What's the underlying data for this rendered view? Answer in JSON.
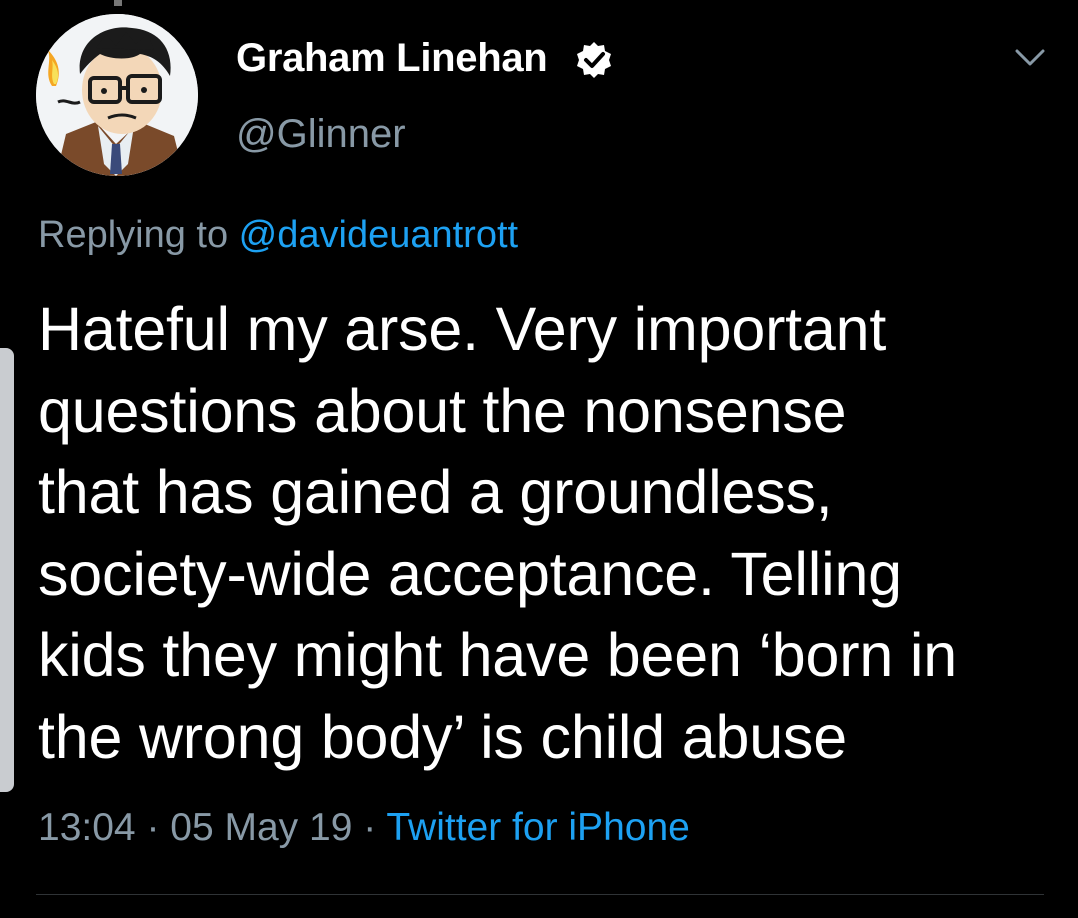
{
  "author": {
    "display_name": "Graham Linehan",
    "handle": "@Glinner",
    "verified": true,
    "avatar": "cartoon-avatar-icon"
  },
  "reply": {
    "prefix": "Replying to ",
    "to_handle": "@davideuantrott"
  },
  "tweet": {
    "text": "Hateful my arse. Very important\nquestions about the nonsense\nthat has  gained a groundless,\nsociety-wide acceptance. Telling\nkids they might have been ‘born in\nthe wrong body’ is child abuse"
  },
  "meta": {
    "time": "13:04",
    "separator": " · ",
    "date": "05 May 19",
    "separator2": " · ",
    "source": "Twitter for iPhone"
  },
  "colors": {
    "background": "#000000",
    "text": "#ffffff",
    "secondary": "#8899a6",
    "accent": "#1da1f2"
  },
  "icons": {
    "verified": "verified-badge-icon",
    "more": "chevron-down-icon"
  }
}
